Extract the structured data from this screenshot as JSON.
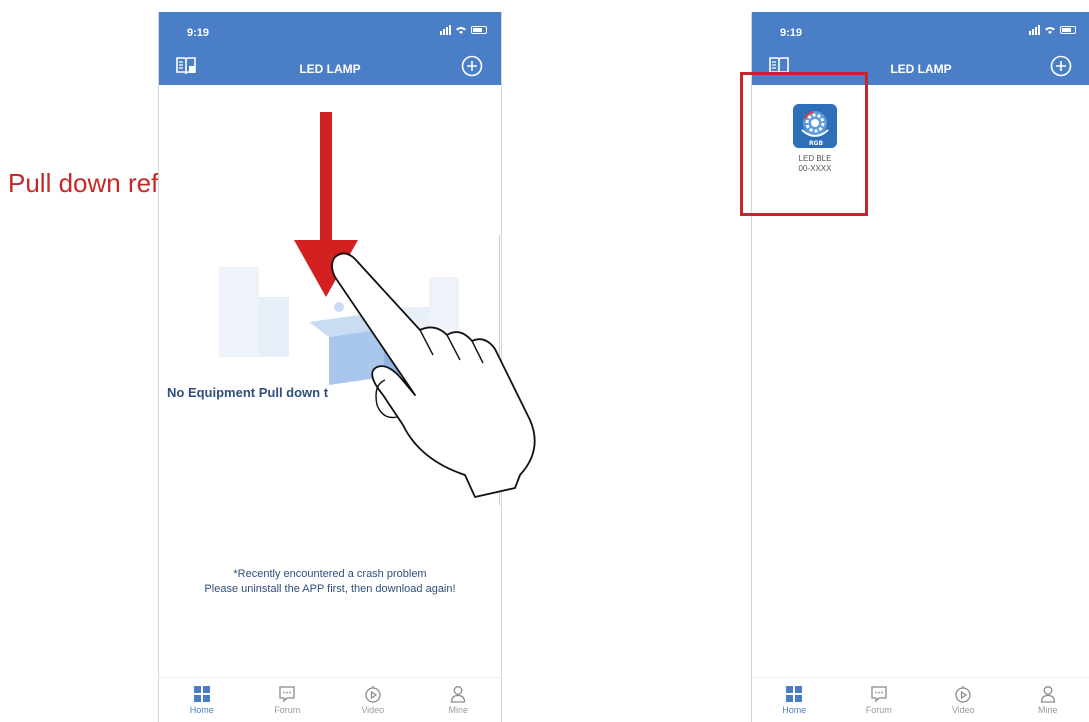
{
  "annotation": {
    "pull_label": "Pull down refresh"
  },
  "status_bar": {
    "time": "9:19"
  },
  "header": {
    "title": "LED LAMP"
  },
  "left_screen": {
    "empty_text": "No Equipment  Pull down t",
    "notice_line1": "*Recently encountered a crash problem",
    "notice_line2": "Please uninstall the APP first, then download again!"
  },
  "right_screen": {
    "device": {
      "name": "LED BLE",
      "id": "00-XXXX",
      "icon_badge": "RGB"
    }
  },
  "tabbar": {
    "items": [
      {
        "label": "Home",
        "icon": "home-grid-icon",
        "active": true
      },
      {
        "label": "Forum",
        "icon": "chat-bubble-icon"
      },
      {
        "label": "Video",
        "icon": "play-circle-icon"
      },
      {
        "label": "Mine",
        "icon": "person-icon"
      }
    ]
  },
  "colors": {
    "header_blue": "#4a7fc8",
    "annotation_red": "#c62828",
    "highlight_red": "#c0282d",
    "text_navy": "#2f4f7d"
  }
}
